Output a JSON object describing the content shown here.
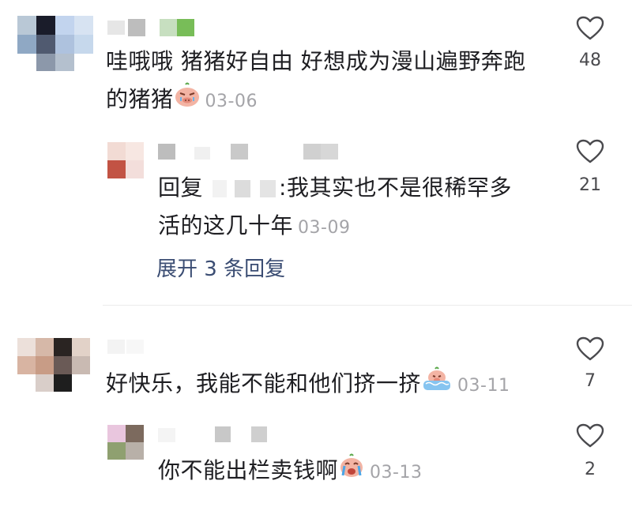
{
  "comments": [
    {
      "text_line1": "哇哦哦 猪猪好自由 好想成为漫山遍野奔跑",
      "text_line2": "的猪猪",
      "emoji": "pig-crying-emoji",
      "date": "03-06",
      "likes": "48",
      "reply": {
        "prefix": "回复",
        "colon": ":",
        "text_line1": "我其实也不是很稀罕多",
        "text_line2": "活的这几十年",
        "date": "03-09",
        "likes": "21"
      },
      "expand_label": "展开 3 条回复"
    },
    {
      "text": "好快乐，我能不能和他们挤一挤",
      "emoji": "pig-hot-spring-emoji",
      "date": "03-11",
      "likes": "7",
      "reply": {
        "text": "你不能出栏卖钱啊",
        "emoji": "pig-sobbing-emoji",
        "date": "03-13",
        "likes": "2"
      }
    }
  ],
  "colors": {
    "text": "#1e1e22",
    "date": "#a4a4a8",
    "link": "#3b4d73",
    "heart_outline": "#4a4a4e"
  }
}
